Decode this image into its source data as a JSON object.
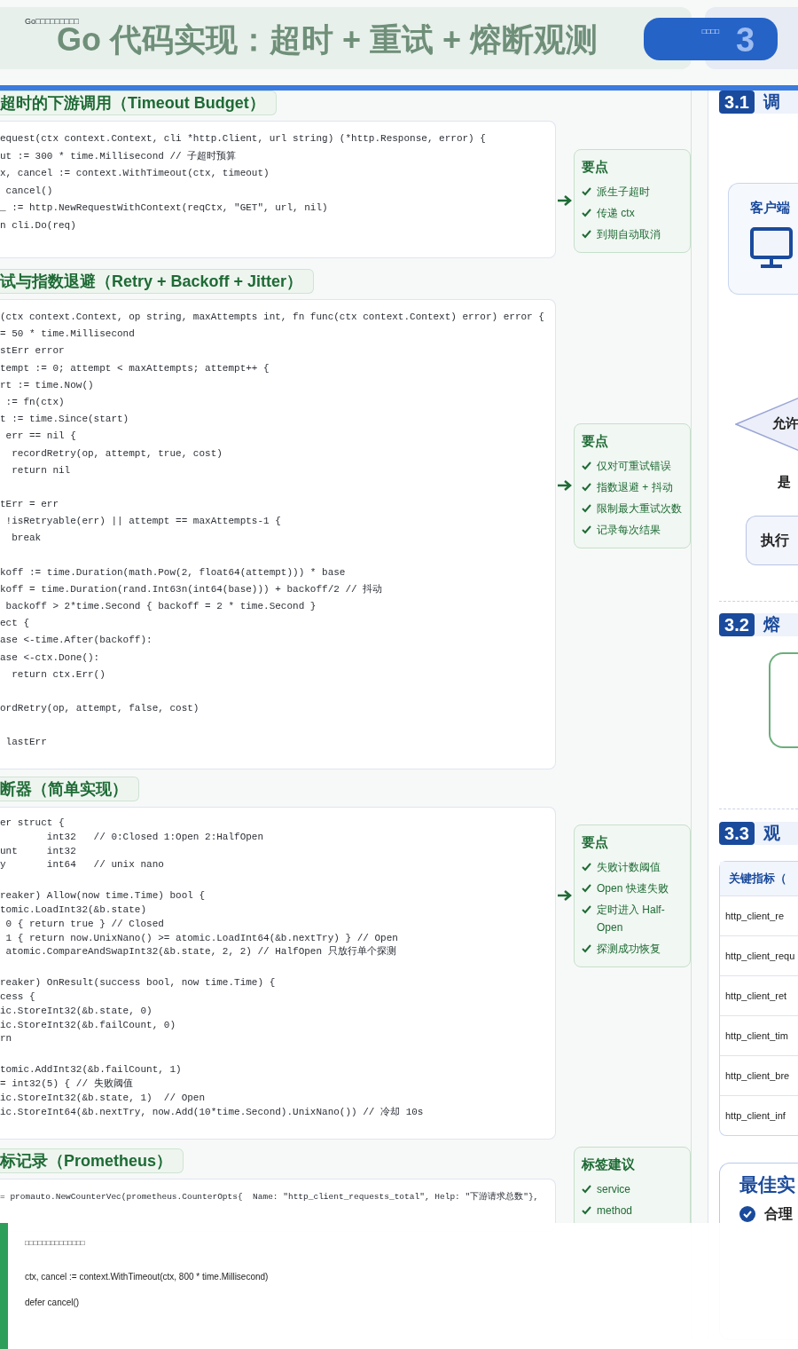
{
  "header": {
    "caption": "Go□□□□□□□□□",
    "title": "Go 代码实现：超时 + 重试 + 熔断观测",
    "button": "□□□□",
    "badge": "3"
  },
  "sections": [
    {
      "heading": "超时的下游调用（Timeout Budget）",
      "code": [
        [
          "equest(ctx context.Context, cli *http.Client, url string) (*http.Response, error) {",
          "ut := 300 * time.Millisecond // 子超时预算",
          "x, cancel := context.WithTimeout(ctx, timeout)",
          " cancel()",
          "_ := http.NewRequestWithContext(reqCtx, \"GET\", url, nil)",
          "n cli.Do(req)"
        ]
      ],
      "notes": {
        "title": "要点",
        "items": [
          "派生子超时",
          "传递 ctx",
          "到期自动取消"
        ]
      }
    },
    {
      "heading": "试与指数退避（Retry + Backoff + Jitter）",
      "code": [
        [
          "(ctx context.Context, op string, maxAttempts int, fn func(ctx context.Context) error) error {",
          "= 50 * time.Millisecond",
          "stErr error",
          "tempt := 0; attempt < maxAttempts; attempt++ {",
          "rt := time.Now()",
          " := fn(ctx)",
          "t := time.Since(start)",
          " err == nil {",
          "  recordRetry(op, attempt, true, cost)",
          "  return nil"
        ],
        [
          "tErr = err",
          " !isRetryable(err) || attempt == maxAttempts-1 {",
          "  break"
        ],
        [
          "koff := time.Duration(math.Pow(2, float64(attempt))) * base",
          "koff = time.Duration(rand.Int63n(int64(base))) + backoff/2 // 抖动",
          " backoff > 2*time.Second { backoff = 2 * time.Second }",
          "ect {",
          "ase <-time.After(backoff):",
          "ase <-ctx.Done():",
          "  return ctx.Err()"
        ],
        [
          "ordRetry(op, attempt, false, cost)"
        ],
        [
          " lastErr"
        ]
      ],
      "notes": {
        "title": "要点",
        "items": [
          "仅对可重试错误",
          "指数退避 + 抖动",
          "限制最大重试次数",
          "记录每次结果"
        ]
      }
    },
    {
      "heading": "断器（简单实现）",
      "code": [
        [
          "er struct {",
          "        int32   // 0:Closed 1:Open 2:HalfOpen",
          "unt     int32",
          "y       int64   // unix nano"
        ],
        [
          "reaker) Allow(now time.Time) bool {",
          "tomic.LoadInt32(&b.state)",
          " 0 { return true } // Closed",
          " 1 { return now.UnixNano() >= atomic.LoadInt64(&b.nextTry) } // Open",
          " atomic.CompareAndSwapInt32(&b.state, 2, 2) // HalfOpen 只放行单个探测"
        ],
        [
          "reaker) OnResult(success bool, now time.Time) {",
          "cess {",
          "ic.StoreInt32(&b.state, 0)",
          "ic.StoreInt32(&b.failCount, 0)",
          "rn"
        ],
        [
          "tomic.AddInt32(&b.failCount, 1)",
          "= int32(5) { // 失败阈值",
          "ic.StoreInt32(&b.state, 1)  // Open",
          "ic.StoreInt64(&b.nextTry, now.Add(10*time.Second).UnixNano()) // 冷却 10s"
        ]
      ],
      "notes": {
        "title": "要点",
        "items": [
          "失败计数阈值",
          "Open 快速失败",
          "定时进入 Half-Open",
          "探测成功恢复"
        ]
      }
    },
    {
      "heading": "标记录（Prometheus）",
      "code": [
        [
          "= promauto.NewCounterVec(prometheus.CounterOpts{  Name: \"http_client_requests_total\", Help: \"下游请求总数\"},"
        ]
      ],
      "notes": {
        "title": "标签建议",
        "items": [
          "service",
          "method"
        ]
      }
    }
  ],
  "right_panel": {
    "flow": {
      "badge": "3.1",
      "title": "调",
      "client_label": "客户端",
      "decision": "允许",
      "yes_label": "是",
      "action": "执行"
    },
    "breaker": {
      "badge": "3.2",
      "title": "熔"
    },
    "observability": {
      "badge": "3.3",
      "title": "观",
      "metrics_title": "关键指标（",
      "metrics": [
        "http_client_re",
        "http_client_requ",
        "http_client_ret",
        "http_client_tim",
        "http_client_bre",
        "http_client_inf"
      ]
    },
    "best_practices": {
      "title": "最佳实",
      "items": [
        "合理"
      ]
    }
  },
  "overlay": {
    "heading": "□□□□□□□□□□□□□□",
    "code": [
      "ctx, cancel := context.WithTimeout(ctx, 800 * time.Millisecond)",
      "defer cancel()"
    ]
  }
}
